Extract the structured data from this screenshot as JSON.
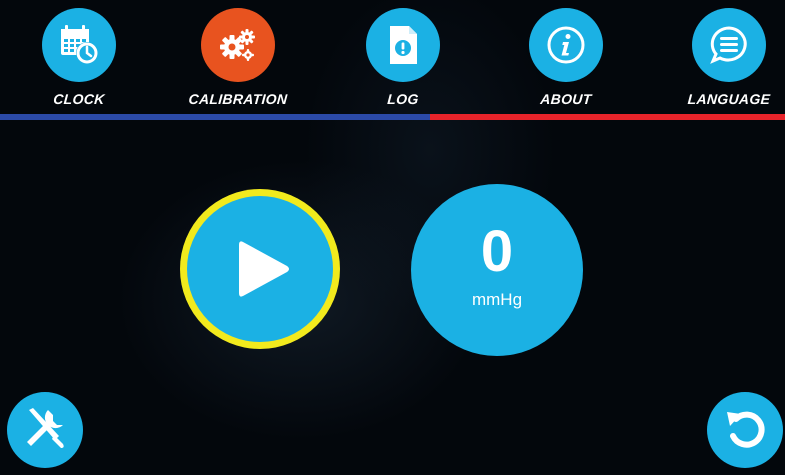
{
  "nav": {
    "items": [
      {
        "label": "CLOCK",
        "icon": "calendar-clock-icon",
        "color": "#1bb1e4"
      },
      {
        "label": "CALIBRATION",
        "icon": "gears-icon",
        "color": "#e8531f"
      },
      {
        "label": "LOG",
        "icon": "log-document-icon",
        "color": "#1bb1e4"
      },
      {
        "label": "ABOUT",
        "icon": "info-icon",
        "color": "#1bb1e4"
      },
      {
        "label": "LANGUAGE",
        "icon": "speech-bubble-icon",
        "color": "#1bb1e4"
      }
    ]
  },
  "colors": {
    "accent": "#1bb1e4",
    "active": "#e8531f",
    "highlight_ring": "#f2ea1d",
    "bar_left": "#2b4aa8",
    "bar_right": "#e8232a"
  },
  "main": {
    "play_icon": "play-icon",
    "gauge": {
      "value": "0",
      "unit": "mmHg"
    }
  },
  "footer": {
    "left_icon": "wrench-screwdriver-icon",
    "right_icon": "undo-arrow-icon"
  }
}
